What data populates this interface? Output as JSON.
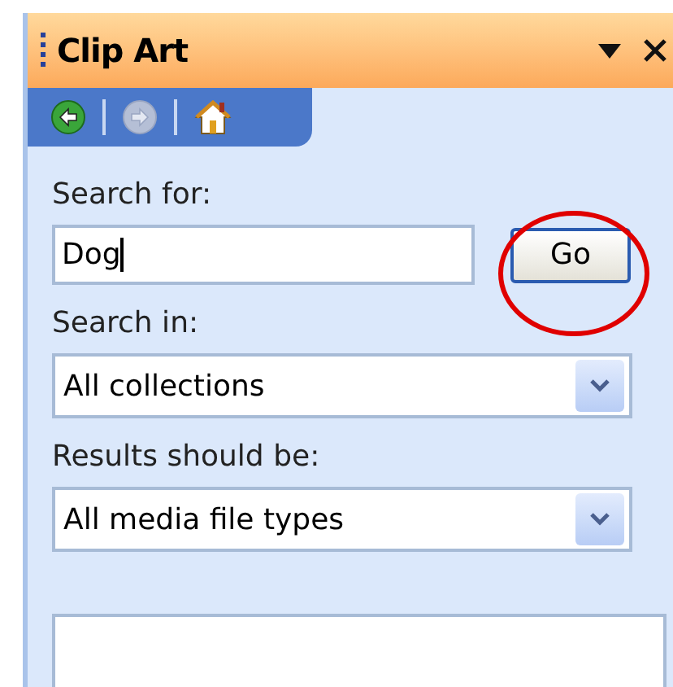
{
  "pane": {
    "title": "Clip Art"
  },
  "nav": [
    {
      "kind": "back",
      "disabled": false
    },
    {
      "kind": "forward",
      "disabled": true
    },
    {
      "kind": "home",
      "disabled": false
    }
  ],
  "search": {
    "label": "Search for:",
    "value": "Dog",
    "button": "Go"
  },
  "search_in": {
    "label": "Search in:",
    "value": "All collections"
  },
  "results_type": {
    "label": "Results should be:",
    "value": "All media file types"
  }
}
